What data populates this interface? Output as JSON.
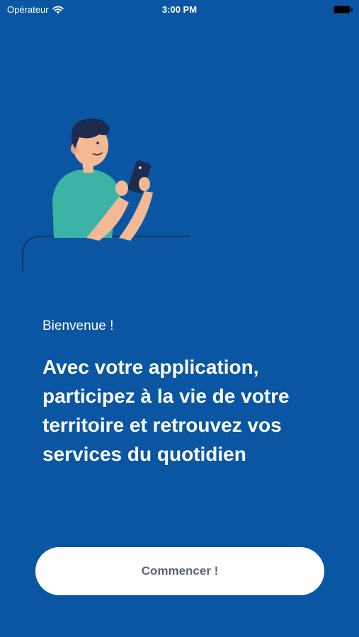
{
  "status_bar": {
    "carrier": "Opérateur",
    "time": "3:00 PM"
  },
  "onboarding": {
    "welcome": "Bienvenue !",
    "headline": "Avec votre application, participez à la vie de votre territoire et retrouvez vos services du quotidien",
    "start_button": "Commencer !"
  },
  "colors": {
    "background": "#0a56a3",
    "button_bg": "#ffffff",
    "button_text": "#5a6478",
    "shirt": "#3bb4a6",
    "skin": "#f3b894",
    "hair": "#1d2b4f"
  },
  "icons": [
    "wifi-icon",
    "battery-icon",
    "person-with-phone-illustration"
  ]
}
